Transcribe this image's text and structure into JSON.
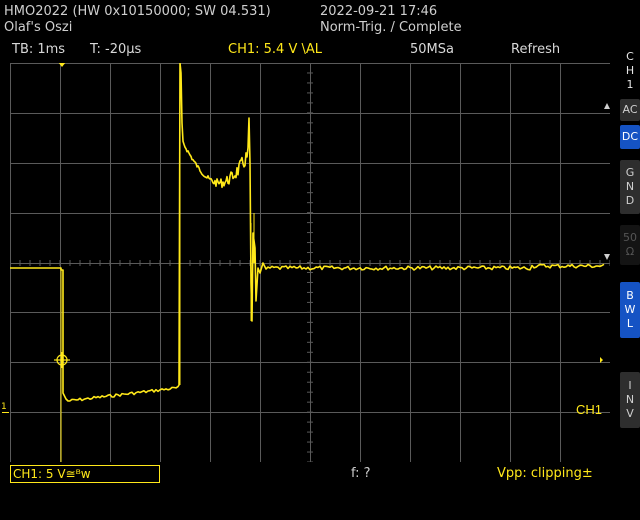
{
  "header": {
    "device": "HMO2022 (HW 0x10150000; SW 04.531)",
    "name": "Olaf's Oszi",
    "datetime": "2022-09-21 17:46",
    "trigger_status": "Norm-Trig. / Complete"
  },
  "info_bar": {
    "timebase": "TB: 1ms",
    "trigger_time": "T: -20µs",
    "channel_trigger": "CH1: 5.4 V \\AL",
    "sample_rate": "50MSa",
    "mode": "Refresh"
  },
  "screen": {
    "ch1_label": "CH1",
    "ch1_ground_marker": "1"
  },
  "sidebar": {
    "channel": [
      "C",
      "H",
      "1"
    ],
    "ac": "AC",
    "dc": "DC",
    "gnd": [
      "G",
      "N",
      "D"
    ],
    "ohm": [
      "50",
      "Ω"
    ],
    "bwl": [
      "B",
      "W",
      "L"
    ],
    "inv": [
      "I",
      "N",
      "V"
    ]
  },
  "status_bar": {
    "ch1_setting": "CH1: 5 V≅ᴮw",
    "frequency": "f: ?",
    "vpp": "Vpp: clipping±"
  },
  "colors": {
    "trace": "#ffe81a",
    "grid": "#5a5a5a",
    "background": "#000000",
    "active_button": "#1553c4"
  }
}
